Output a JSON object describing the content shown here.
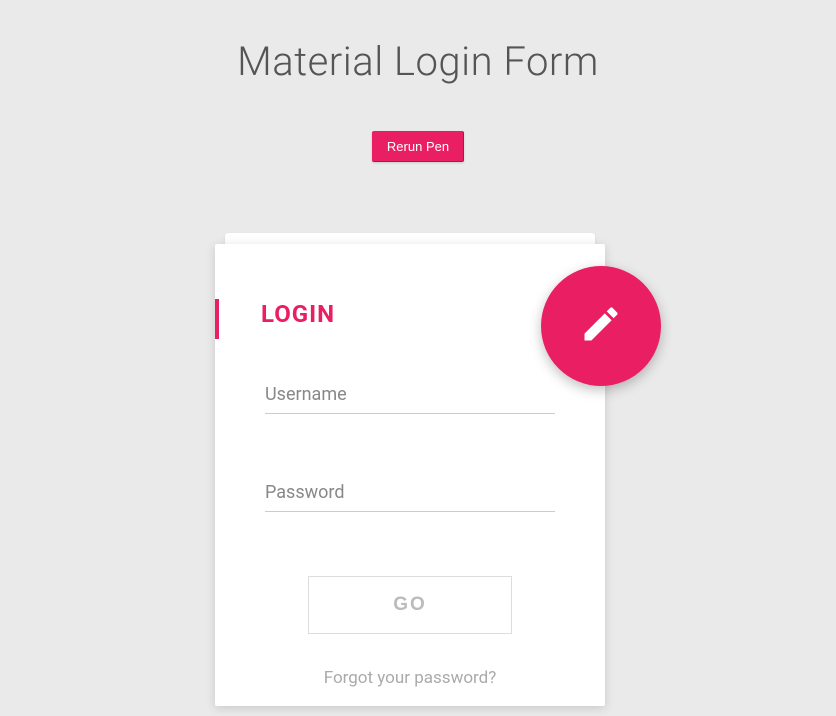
{
  "header": {
    "title": "Material Login Form"
  },
  "rerun": {
    "label": "Rerun Pen"
  },
  "card": {
    "title": "LOGIN",
    "fab_icon": "pencil-icon",
    "fields": {
      "username": {
        "label": "Username",
        "value": ""
      },
      "password": {
        "label": "Password",
        "value": ""
      }
    },
    "submit_label": "GO",
    "forgot_label": "Forgot your password?"
  },
  "colors": {
    "accent": "#e91e63",
    "background": "#eaeaea"
  }
}
